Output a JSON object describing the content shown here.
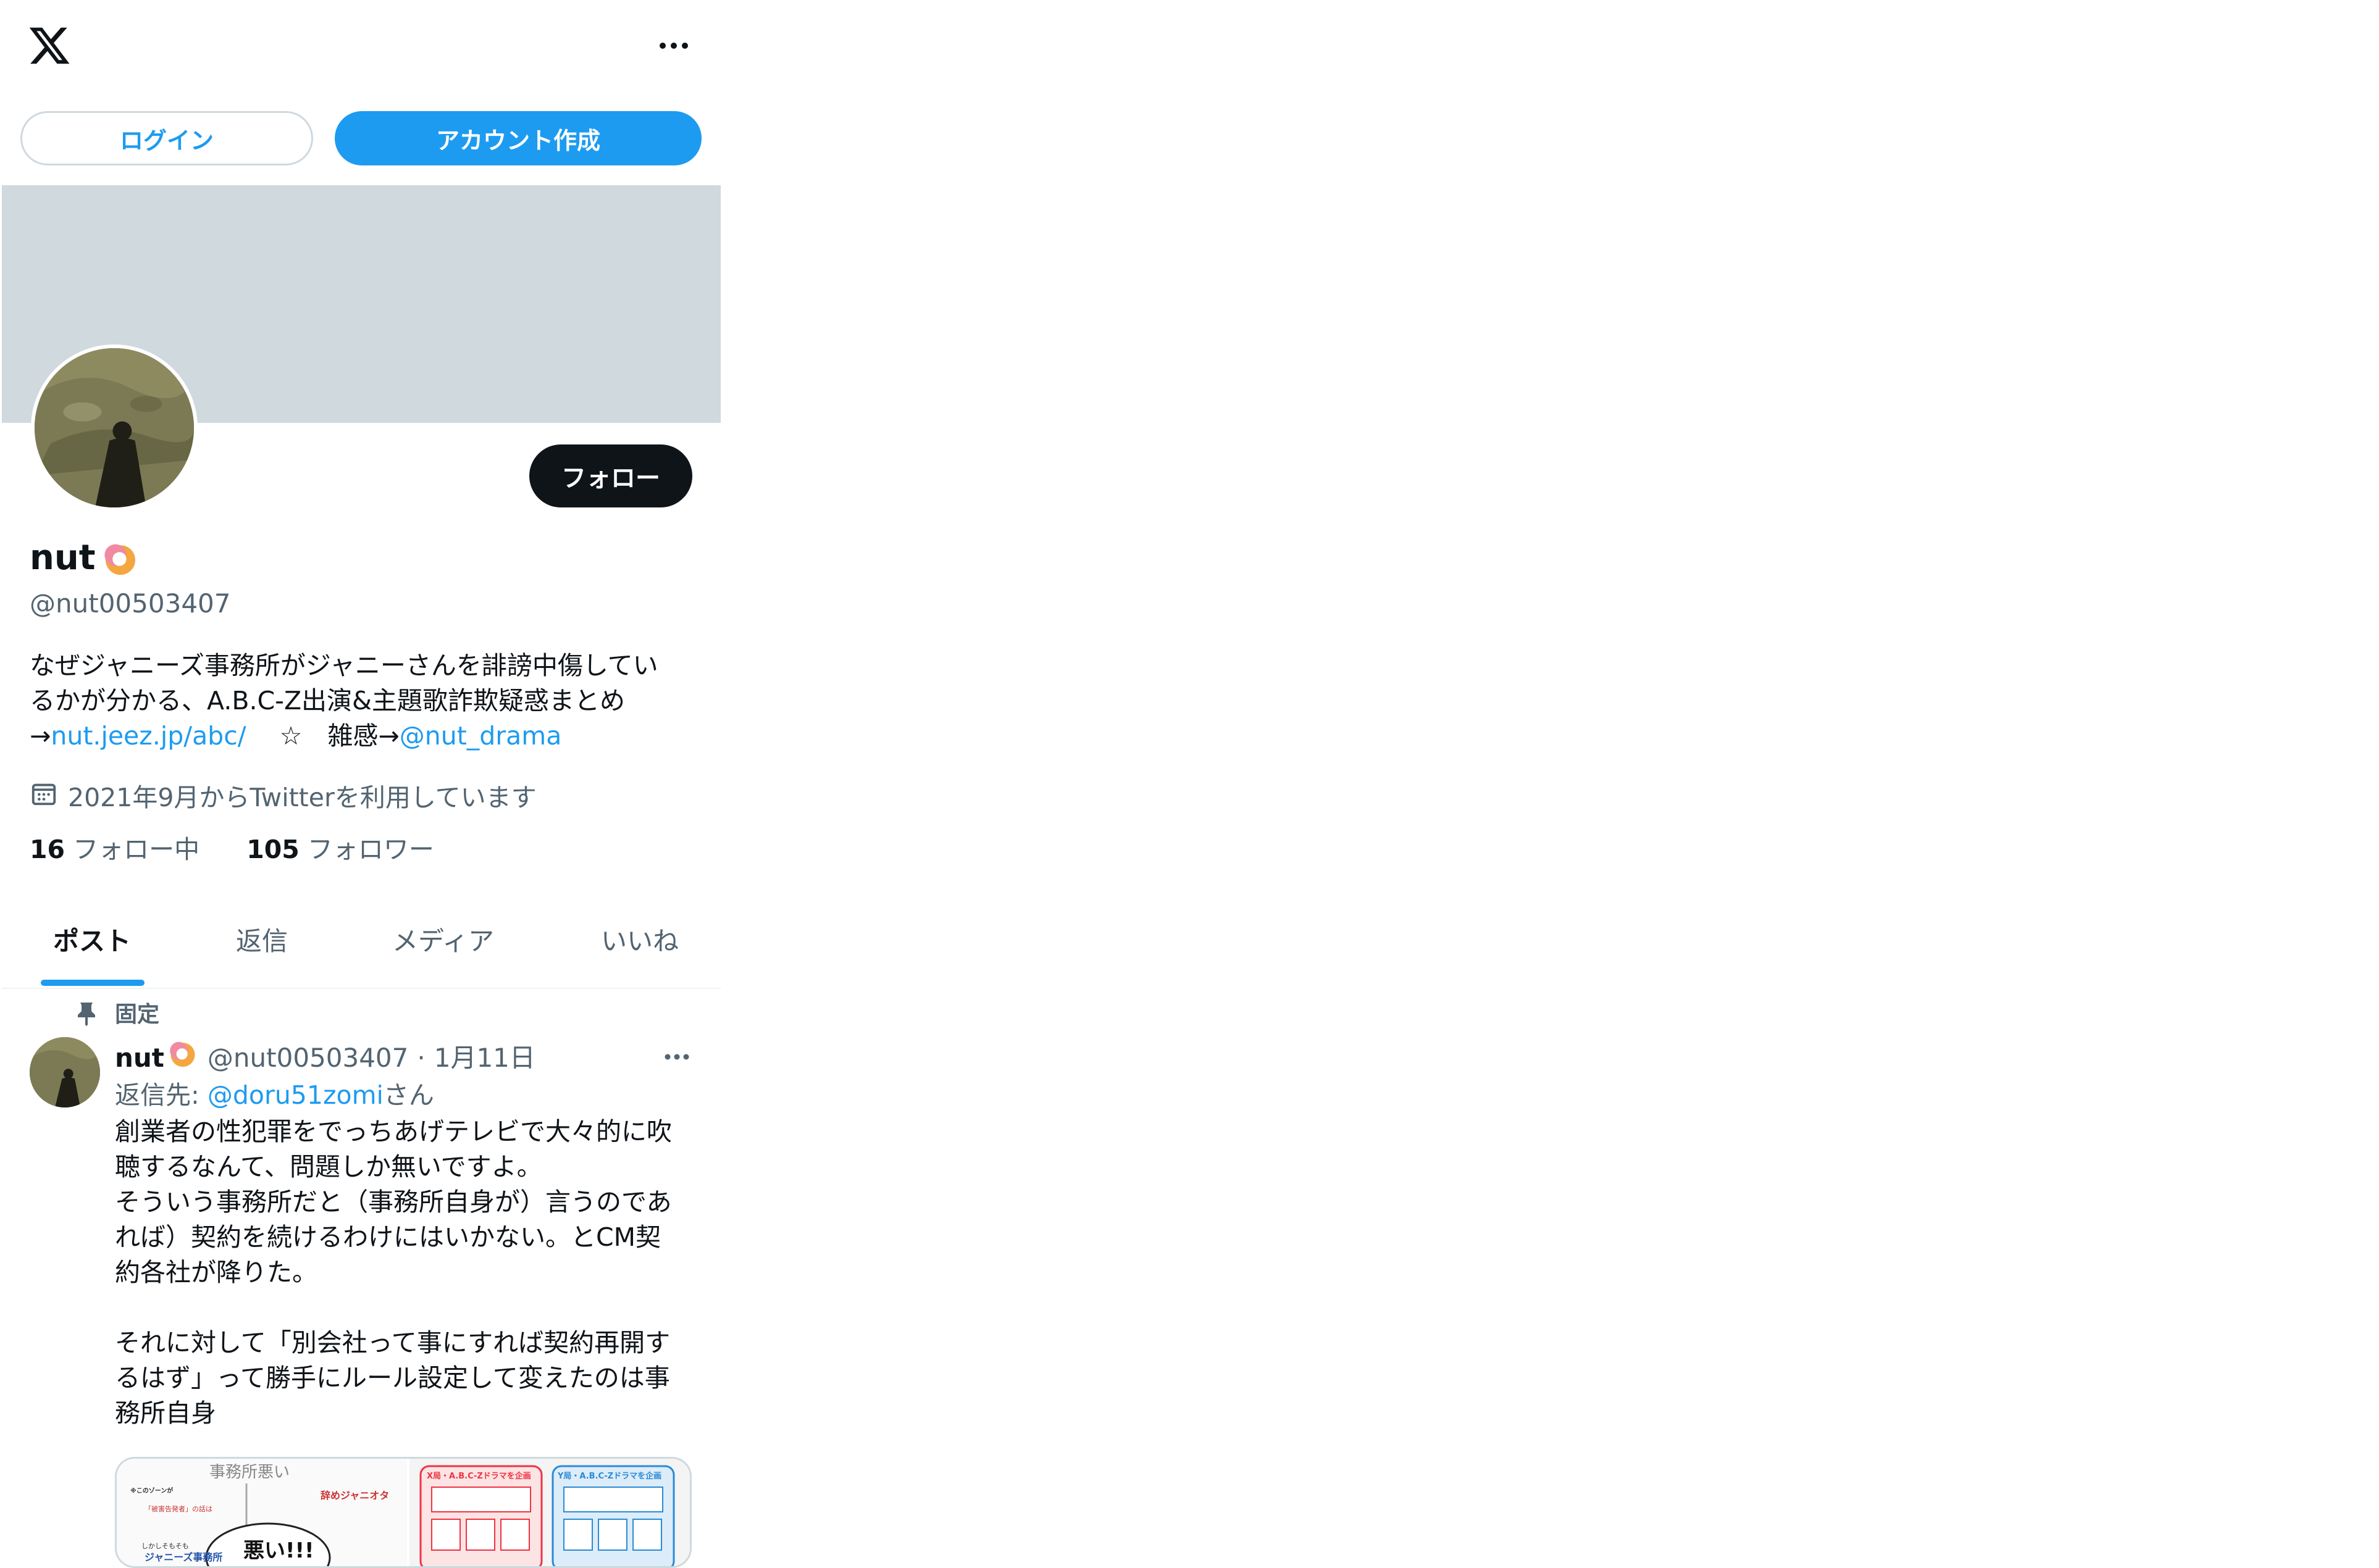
{
  "header": {
    "logo": "x-logo-icon",
    "more": "more-horizontal-icon"
  },
  "auth": {
    "login_label": "ログイン",
    "signup_label": "アカウント作成"
  },
  "profile": {
    "follow_label": "フォロー",
    "name": "nut",
    "handle": "@nut00503407",
    "bio_line1": "なぜジャニーズ事務所がジャニーさんを誹謗中傷してい",
    "bio_line2": "るかが分かる、A.B.C-Z出演&主題歌詐欺疑惑まとめ",
    "bio_arrow1": "→",
    "bio_link": "nut.jeez.jp/abc/",
    "bio_mid": " 　☆　雑感→",
    "bio_mention": "@nut_drama",
    "joined": "2021年9月からTwitterを利用しています",
    "following_count": "16",
    "following_label": " フォロー中",
    "followers_count": "105",
    "followers_label": " フォロワー"
  },
  "tabs": [
    {
      "label": "ポスト"
    },
    {
      "label": "返信"
    },
    {
      "label": "メディア"
    },
    {
      "label": "いいね"
    }
  ],
  "tweet": {
    "pinned_label": "固定",
    "name": "nut",
    "handle": "@nut00503407",
    "separator": "·",
    "date": "1月11日",
    "reply_prefix": "返信先: ",
    "reply_mention": "@doru51zomi",
    "reply_suffix": "さん",
    "text": "創業者の性犯罪をでっちあげテレビで大々的に吹\n聴するなんて、問題しか無いですよ。\nそういう事務所だと（事務所自身が）言うのであ\nれば）契約を続けるわけにはいかない。とCM契\n約各社が降りた。\n\nそれに対して「別会社って事にすれば契約再開す\nるはず」って勝手にルール設定して変えたのは事\n務所自身",
    "media": {
      "panel1_title": "事務所悪い",
      "panel1_caption_small": "※このゾーンが\nサイレントマジョリティーでは?",
      "panel1_quote": "「被害告発者」の話は\n信用できない、根拠的",
      "panel1_red": "辞めジャニオタ\nアンチジャニ",
      "panel1_big": "悪い!!!",
      "panel1_bottom": "ジャニーズ事務所",
      "panel1_bottom_small": "しかしそもそも",
      "panel2_title": "X局・A.B.C-Zドラマを企画",
      "panel3_title": "Y局・A.B.C-Zドラマを企画"
    }
  },
  "colors": {
    "accent": "#1d9bf0",
    "banner": "#cfd9de",
    "text": "#0f1419",
    "muted": "#536471",
    "follow_button": "#0f1419"
  }
}
